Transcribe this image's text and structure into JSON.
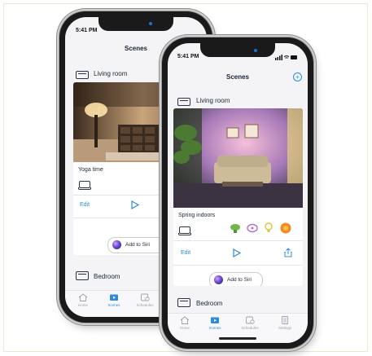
{
  "back_phone": {
    "time": "5:41 PM",
    "signal": "▐▐ ◠ ▬",
    "nav_title": "Scenes",
    "room_title": "Living room",
    "scene_name": "Yoga time",
    "edit_label": "Edit",
    "siri_label": "Add to Siri",
    "next_room_title": "Bedroom",
    "tabs": [
      {
        "label": "Home",
        "icon": "home-icon"
      },
      {
        "label": "Scenes",
        "icon": "scenes-icon"
      },
      {
        "label": "Schedules",
        "icon": "schedules-icon"
      }
    ]
  },
  "front_phone": {
    "time": "5:41 PM",
    "signal": "▐▐ ◠ ▬",
    "nav_title": "Scenes",
    "add_icon": "plus-circle-icon",
    "room_title": "Living room",
    "scene_name": "Spring indoors",
    "edit_label": "Edit",
    "siri_label": "Add to Siri",
    "next_room_title": "Bedroom",
    "colors": {
      "accent": "#2b8be0",
      "green": "#74b649",
      "purple": "#b06bd6",
      "yellow": "#e0c33c",
      "orange": "#f08a24"
    },
    "tabs": [
      {
        "label": "Home",
        "icon": "home-icon"
      },
      {
        "label": "Scenes",
        "icon": "scenes-icon"
      },
      {
        "label": "Schedules",
        "icon": "schedules-icon"
      },
      {
        "label": "Settings",
        "icon": "settings-icon"
      }
    ]
  }
}
